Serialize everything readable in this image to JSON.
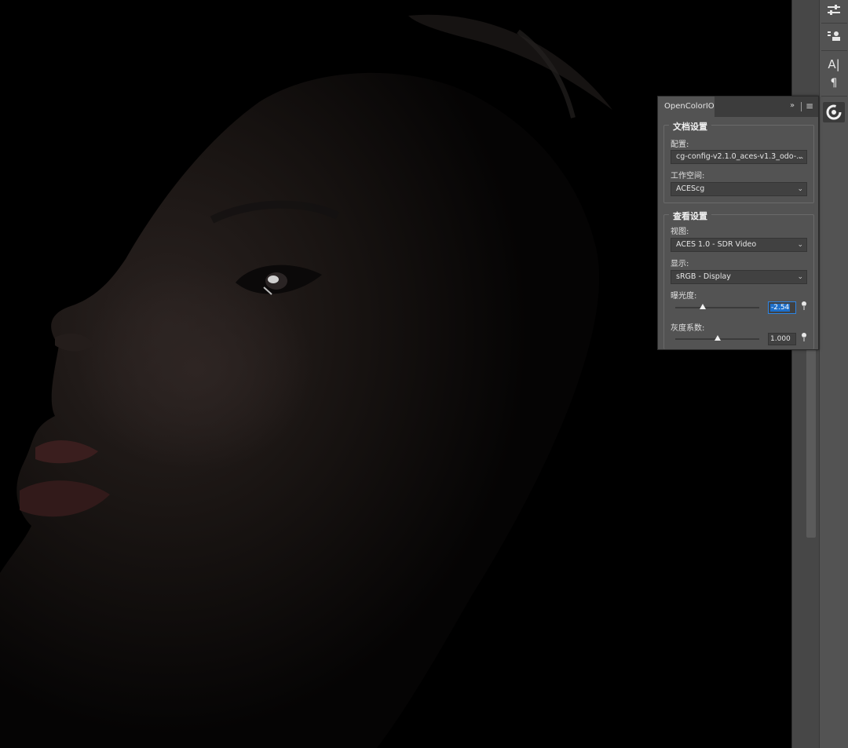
{
  "panel": {
    "tab_title": "OpenColorIO",
    "collapse_glyph": "»",
    "menu_glyph": "≡",
    "doc_settings": {
      "title": "文档设置",
      "config_label": "配置:",
      "config_value": "cg-config-v2.1.0_aces-v1.3_odo-...",
      "working_space_label": "工作空间:",
      "working_space_value": "ACEScg"
    },
    "view_settings": {
      "title": "查看设置",
      "view_label": "视图:",
      "view_value": "ACES 1.0 - SDR Video",
      "display_label": "显示:",
      "display_value": "sRGB - Display",
      "exposure_label": "曝光度:",
      "exposure_value": "-2.54",
      "exposure_slider_fraction": 0.33,
      "gamma_label": "灰度系数:",
      "gamma_value": "1.000",
      "gamma_slider_fraction": 0.5
    }
  },
  "toolbar": {
    "icons": [
      "adjustments-icon",
      "properties-icon",
      "character-icon",
      "paragraph-icon",
      "opencolorio-icon"
    ]
  },
  "colors": {
    "panel_bg": "#535353",
    "selection_blue": "#1e6fc9",
    "canvas_bg": "#000000"
  }
}
